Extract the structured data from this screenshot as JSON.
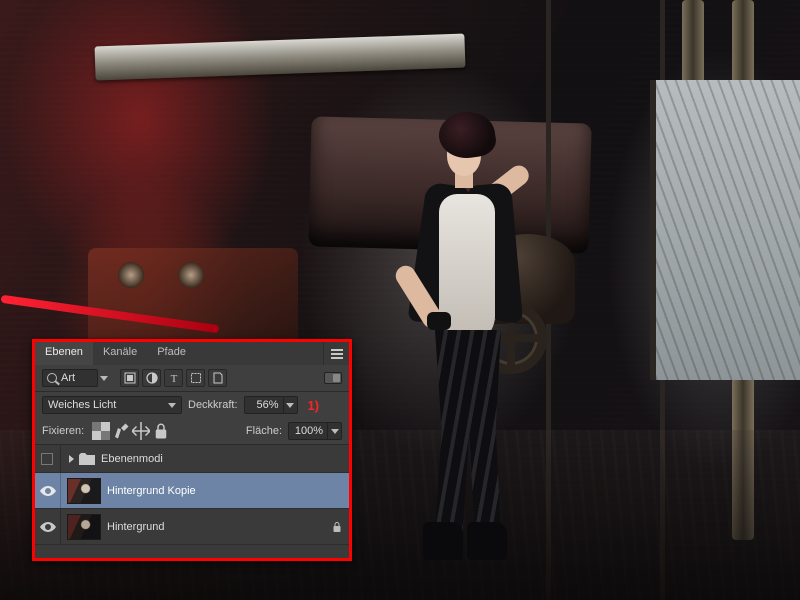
{
  "panel": {
    "tabs": {
      "layers": "Ebenen",
      "channels": "Kanäle",
      "paths": "Pfade"
    },
    "filter_kind": "Art",
    "blend_mode": "Weiches Licht",
    "opacity_label": "Deckkraft:",
    "opacity_value": "56%",
    "lock_label": "Fixieren:",
    "fill_label": "Fläche:",
    "fill_value": "100%",
    "annotation": "1)"
  },
  "layers": {
    "group": "Ebenenmodi",
    "copy": "Hintergrund Kopie",
    "bg": "Hintergrund"
  }
}
